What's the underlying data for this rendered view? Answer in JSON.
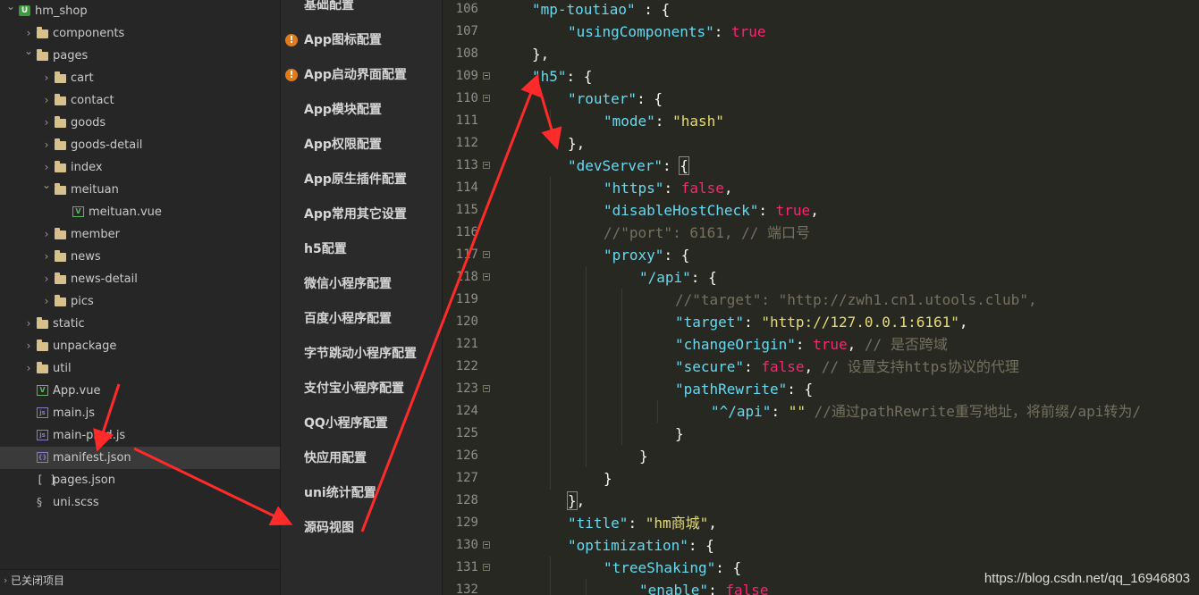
{
  "file_tree": {
    "rows": [
      {
        "kind": "project",
        "label": "hm_shop",
        "depth": 0,
        "expanded": true,
        "icon": "project-icon"
      },
      {
        "kind": "folder",
        "label": "components",
        "depth": 1,
        "expanded": false,
        "icon": "folder-icon"
      },
      {
        "kind": "folder",
        "label": "pages",
        "depth": 1,
        "expanded": true,
        "icon": "folder-open-icon"
      },
      {
        "kind": "folder",
        "label": "cart",
        "depth": 2,
        "expanded": false,
        "icon": "folder-icon"
      },
      {
        "kind": "folder",
        "label": "contact",
        "depth": 2,
        "expanded": false,
        "icon": "folder-icon"
      },
      {
        "kind": "folder",
        "label": "goods",
        "depth": 2,
        "expanded": false,
        "icon": "folder-icon"
      },
      {
        "kind": "folder",
        "label": "goods-detail",
        "depth": 2,
        "expanded": false,
        "icon": "folder-icon"
      },
      {
        "kind": "folder",
        "label": "index",
        "depth": 2,
        "expanded": false,
        "icon": "folder-icon"
      },
      {
        "kind": "folder",
        "label": "meituan",
        "depth": 2,
        "expanded": true,
        "icon": "folder-open-icon"
      },
      {
        "kind": "vue",
        "label": "meituan.vue",
        "depth": 3,
        "icon": "vue-file-icon"
      },
      {
        "kind": "folder",
        "label": "member",
        "depth": 2,
        "expanded": false,
        "icon": "folder-icon"
      },
      {
        "kind": "folder",
        "label": "news",
        "depth": 2,
        "expanded": false,
        "icon": "folder-icon"
      },
      {
        "kind": "folder",
        "label": "news-detail",
        "depth": 2,
        "expanded": false,
        "icon": "folder-icon"
      },
      {
        "kind": "folder",
        "label": "pics",
        "depth": 2,
        "expanded": false,
        "icon": "folder-icon"
      },
      {
        "kind": "folder",
        "label": "static",
        "depth": 1,
        "expanded": false,
        "icon": "folder-icon"
      },
      {
        "kind": "folder",
        "label": "unpackage",
        "depth": 1,
        "expanded": false,
        "icon": "folder-icon"
      },
      {
        "kind": "folder",
        "label": "util",
        "depth": 1,
        "expanded": false,
        "icon": "folder-icon"
      },
      {
        "kind": "vue",
        "label": "App.vue",
        "depth": 1,
        "icon": "vue-file-icon"
      },
      {
        "kind": "js",
        "label": "main.js",
        "depth": 1,
        "icon": "js-file-icon"
      },
      {
        "kind": "js",
        "label": "main-prod.js",
        "depth": 1,
        "icon": "js-file-icon"
      },
      {
        "kind": "json",
        "label": "manifest.json",
        "depth": 1,
        "icon": "json-file-icon",
        "selected": true
      },
      {
        "kind": "pages",
        "label": "pages.json",
        "depth": 1,
        "icon": "brackets-file-icon"
      },
      {
        "kind": "scss",
        "label": "uni.scss",
        "depth": 1,
        "icon": "scss-file-icon"
      }
    ],
    "closed_projects_label": "已关闭项目"
  },
  "settings_menu": {
    "items": [
      {
        "label": "基础配置",
        "warn": false
      },
      {
        "label": "App图标配置",
        "warn": true
      },
      {
        "label": "App启动界面配置",
        "warn": true
      },
      {
        "label": "App模块配置",
        "warn": false
      },
      {
        "label": "App权限配置",
        "warn": false
      },
      {
        "label": "App原生插件配置",
        "warn": false
      },
      {
        "label": "App常用其它设置",
        "warn": false
      },
      {
        "label": "h5配置",
        "warn": false
      },
      {
        "label": "微信小程序配置",
        "warn": false
      },
      {
        "label": "百度小程序配置",
        "warn": false
      },
      {
        "label": "字节跳动小程序配置",
        "warn": false
      },
      {
        "label": "支付宝小程序配置",
        "warn": false
      },
      {
        "label": "QQ小程序配置",
        "warn": false
      },
      {
        "label": "快应用配置",
        "warn": false
      },
      {
        "label": "uni统计配置",
        "warn": false
      },
      {
        "label": "源码视图",
        "warn": false
      }
    ]
  },
  "editor": {
    "lines": [
      {
        "n": "106",
        "fold": false,
        "indent": 1,
        "tokens": [
          [
            "key",
            "\"mp-toutiao\""
          ],
          [
            "pun",
            " : {"
          ]
        ]
      },
      {
        "n": "107",
        "fold": false,
        "indent": 2,
        "tokens": [
          [
            "key",
            "\"usingComponents\""
          ],
          [
            "pun",
            ": "
          ],
          [
            "bool",
            "true"
          ]
        ]
      },
      {
        "n": "108",
        "fold": false,
        "indent": 1,
        "tokens": [
          [
            "pun",
            "},"
          ]
        ]
      },
      {
        "n": "109",
        "fold": true,
        "indent": 1,
        "tokens": [
          [
            "key",
            "\"h5\""
          ],
          [
            "pun",
            ": {"
          ]
        ]
      },
      {
        "n": "110",
        "fold": true,
        "indent": 2,
        "tokens": [
          [
            "key",
            "\"router\""
          ],
          [
            "pun",
            ": {"
          ]
        ]
      },
      {
        "n": "111",
        "fold": false,
        "indent": 3,
        "tokens": [
          [
            "key",
            "\"mode\""
          ],
          [
            "pun",
            ": "
          ],
          [
            "str",
            "\"hash\""
          ]
        ]
      },
      {
        "n": "112",
        "fold": false,
        "indent": 2,
        "tokens": [
          [
            "pun",
            "},"
          ]
        ]
      },
      {
        "n": "113",
        "fold": true,
        "indent": 2,
        "tokens": [
          [
            "key",
            "\"devServer\""
          ],
          [
            "pun",
            ": "
          ],
          [
            "brk",
            "{"
          ]
        ]
      },
      {
        "n": "114",
        "fold": false,
        "indent": 3,
        "tokens": [
          [
            "key",
            "\"https\""
          ],
          [
            "pun",
            ": "
          ],
          [
            "bool",
            "false"
          ],
          [
            "pun",
            ","
          ]
        ]
      },
      {
        "n": "115",
        "fold": false,
        "indent": 3,
        "tokens": [
          [
            "key",
            "\"disableHostCheck\""
          ],
          [
            "pun",
            ": "
          ],
          [
            "bool",
            "true"
          ],
          [
            "pun",
            ","
          ]
        ]
      },
      {
        "n": "116",
        "fold": false,
        "indent": 3,
        "tokens": [
          [
            "cmt",
            "//\"port\": 6161, // 端口号"
          ]
        ]
      },
      {
        "n": "117",
        "fold": true,
        "indent": 3,
        "tokens": [
          [
            "key",
            "\"proxy\""
          ],
          [
            "pun",
            ": {"
          ]
        ]
      },
      {
        "n": "118",
        "fold": true,
        "indent": 4,
        "tokens": [
          [
            "key",
            "\"/api\""
          ],
          [
            "pun",
            ": {"
          ]
        ]
      },
      {
        "n": "119",
        "fold": false,
        "indent": 5,
        "tokens": [
          [
            "cmt",
            "//\"target\": \"http://zwh1.cn1.utools.club\","
          ]
        ]
      },
      {
        "n": "120",
        "fold": false,
        "indent": 5,
        "tokens": [
          [
            "key",
            "\"target\""
          ],
          [
            "pun",
            ": "
          ],
          [
            "str",
            "\"http://127.0.0.1:6161\""
          ],
          [
            "pun",
            ","
          ]
        ]
      },
      {
        "n": "121",
        "fold": false,
        "indent": 5,
        "tokens": [
          [
            "key",
            "\"changeOrigin\""
          ],
          [
            "pun",
            ": "
          ],
          [
            "bool",
            "true"
          ],
          [
            "pun",
            ", "
          ],
          [
            "cmt",
            "// 是否跨域"
          ]
        ]
      },
      {
        "n": "122",
        "fold": false,
        "indent": 5,
        "tokens": [
          [
            "key",
            "\"secure\""
          ],
          [
            "pun",
            ": "
          ],
          [
            "bool",
            "false"
          ],
          [
            "pun",
            ", "
          ],
          [
            "cmt",
            "// 设置支持https协议的代理"
          ]
        ]
      },
      {
        "n": "123",
        "fold": true,
        "indent": 5,
        "tokens": [
          [
            "key",
            "\"pathRewrite\""
          ],
          [
            "pun",
            ": {"
          ]
        ]
      },
      {
        "n": "124",
        "fold": false,
        "indent": 6,
        "tokens": [
          [
            "key",
            "\"^/api\""
          ],
          [
            "pun",
            ": "
          ],
          [
            "str",
            "\"\""
          ],
          [
            "pun",
            " "
          ],
          [
            "cmt",
            "//通过pathRewrite重写地址，将前缀/api转为/"
          ]
        ]
      },
      {
        "n": "125",
        "fold": false,
        "indent": 5,
        "tokens": [
          [
            "pun",
            "}"
          ]
        ]
      },
      {
        "n": "126",
        "fold": false,
        "indent": 4,
        "tokens": [
          [
            "pun",
            "}"
          ]
        ]
      },
      {
        "n": "127",
        "fold": false,
        "indent": 3,
        "tokens": [
          [
            "pun",
            "}"
          ]
        ]
      },
      {
        "n": "128",
        "fold": false,
        "indent": 2,
        "tokens": [
          [
            "brk",
            "}"
          ],
          [
            "pun",
            ","
          ]
        ]
      },
      {
        "n": "129",
        "fold": false,
        "indent": 2,
        "tokens": [
          [
            "key",
            "\"title\""
          ],
          [
            "pun",
            ": "
          ],
          [
            "str",
            "\"hm商城\""
          ],
          [
            "pun",
            ","
          ]
        ]
      },
      {
        "n": "130",
        "fold": true,
        "indent": 2,
        "tokens": [
          [
            "key",
            "\"optimization\""
          ],
          [
            "pun",
            ": {"
          ]
        ]
      },
      {
        "n": "131",
        "fold": true,
        "indent": 3,
        "tokens": [
          [
            "key",
            "\"treeShaking\""
          ],
          [
            "pun",
            ": {"
          ]
        ]
      },
      {
        "n": "132",
        "fold": false,
        "indent": 4,
        "tokens": [
          [
            "key",
            "\"enable\""
          ],
          [
            "pun",
            ": "
          ],
          [
            "bool",
            "false"
          ]
        ]
      }
    ]
  },
  "watermark": "https://blog.csdn.net/qq_16946803",
  "annotation_color": "#ff2a2a",
  "syntax_colors": {
    "key": "#66d9ef",
    "str": "#e6db74",
    "bool": "#f92672",
    "cmt": "#75715e",
    "pun": "#f8f8f2"
  }
}
